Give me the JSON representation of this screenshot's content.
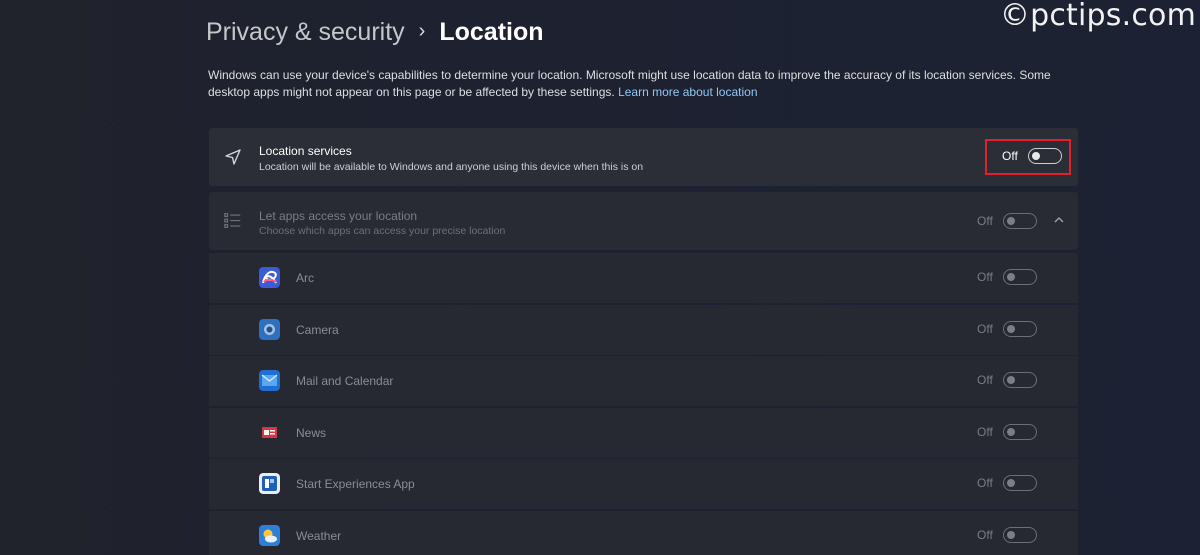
{
  "watermark": "©pctips.com",
  "breadcrumb": {
    "parent": "Privacy & security",
    "separator": "›",
    "current": "Location"
  },
  "description": {
    "text": "Windows can use your device's capabilities to determine your location. Microsoft might use location data to improve the accuracy of its location services. Some desktop apps might not appear on this page or be affected by these settings.",
    "link": "Learn more about location"
  },
  "location_services": {
    "title": "Location services",
    "subtitle": "Location will be available to Windows and anyone using this device when this is on",
    "state": "Off",
    "icon": "navigation-arrow-icon"
  },
  "let_apps": {
    "title": "Let apps access your location",
    "subtitle": "Choose which apps can access your precise location",
    "state": "Off",
    "icon": "list-icon"
  },
  "apps": [
    {
      "name": "Arc",
      "state": "Off",
      "icon": "arc-icon"
    },
    {
      "name": "Camera",
      "state": "Off",
      "icon": "camera-icon"
    },
    {
      "name": "Mail and Calendar",
      "state": "Off",
      "icon": "mail-icon"
    },
    {
      "name": "News",
      "state": "Off",
      "icon": "news-icon"
    },
    {
      "name": "Start Experiences App",
      "state": "Off",
      "icon": "start-experiences-icon"
    },
    {
      "name": "Weather",
      "state": "Off",
      "icon": "weather-icon"
    }
  ],
  "colors": {
    "highlight": "#e0202a",
    "link": "#8fc8f5"
  }
}
